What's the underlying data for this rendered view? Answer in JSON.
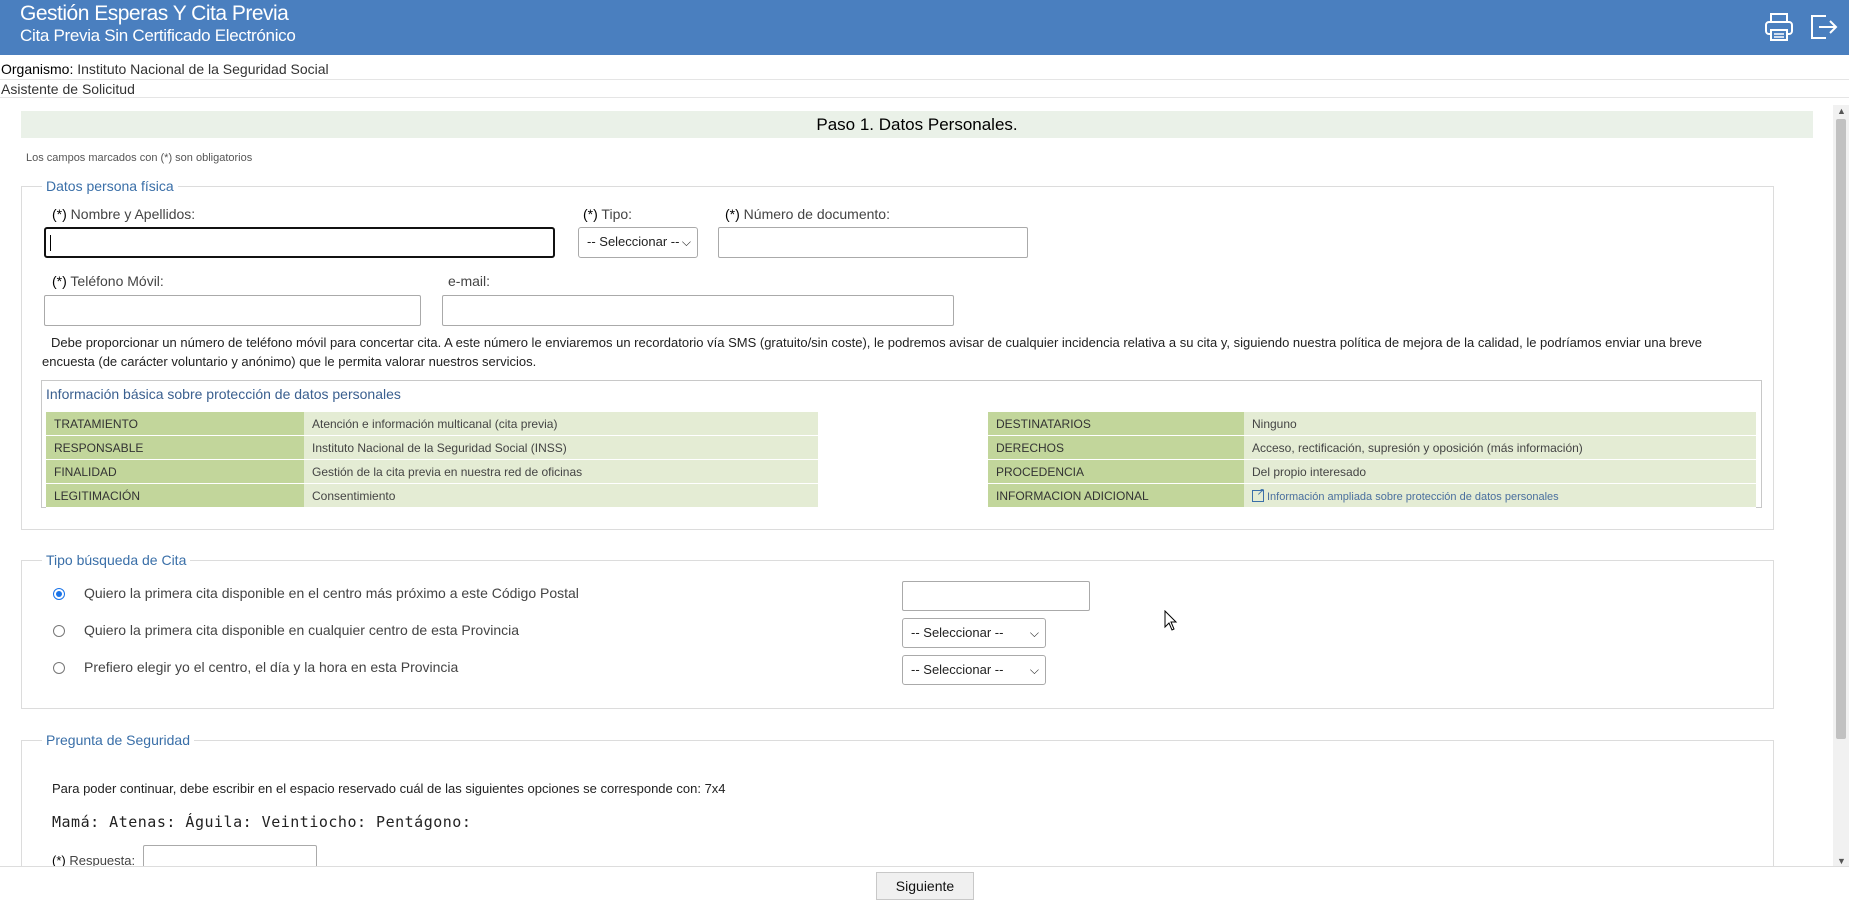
{
  "header": {
    "title": "Gestión Esperas Y Cita Previa",
    "subtitle": "Cita Previa Sin Certificado Electrónico",
    "icons": [
      "printer-icon",
      "logout-icon"
    ]
  },
  "organismo": {
    "label": "Organismo:",
    "value": "Instituto Nacional de la Seguridad Social"
  },
  "asistente": "Asistente de Solicitud",
  "step_title": "Paso 1. Datos Personales.",
  "required_note": "Los campos marcados con (*) son obligatorios",
  "persona": {
    "legend": "Datos persona física",
    "req": "(*)",
    "nombre_label": "Nombre y Apellidos:",
    "nombre_value": "",
    "tipo_label": "Tipo:",
    "tipo_value": "-- Seleccionar --",
    "documento_label": "Número de documento:",
    "documento_value": "",
    "telefono_label": "Teléfono Móvil:",
    "telefono_value": "",
    "email_label": "e-mail:",
    "email_value": "",
    "sms_note": "Debe proporcionar un número de teléfono móvil para concertar cita. A este número le enviaremos un recordatorio vía SMS (gratuito/sin coste), le podremos avisar de cualquier incidencia relativa a su cita y, siguiendo nuestra política de mejora de la calidad, le podríamos enviar una breve encuesta (de carácter voluntario y anónimo) que le permita valorar nuestros servicios."
  },
  "gdpr": {
    "title": "Información básica sobre protección de datos personales",
    "rows": [
      {
        "k1": "TRATAMIENTO",
        "v1": "Atención e información multicanal (cita previa)",
        "k2": "DESTINATARIOS",
        "v2": "Ninguno"
      },
      {
        "k1": "RESPONSABLE",
        "v1": "Instituto Nacional de la Seguridad Social (INSS)",
        "k2": "DERECHOS",
        "v2": "Acceso, rectificación, supresión y oposición (más información)"
      },
      {
        "k1": "FINALIDAD",
        "v1": "Gestión de la cita previa en nuestra red de oficinas",
        "k2": "PROCEDENCIA",
        "v2": "Del propio interesado"
      },
      {
        "k1": "LEGITIMACIÓN",
        "v1": "Consentimiento",
        "k2": "INFORMACION ADICIONAL",
        "v2": "Información ampliada sobre protección de datos personales"
      }
    ]
  },
  "busqueda": {
    "legend": "Tipo búsqueda de Cita",
    "options": [
      {
        "label": "Quiero la primera cita disponible en el centro más próximo a este Código Postal",
        "selected": true,
        "control_value": ""
      },
      {
        "label": "Quiero la primera cita disponible en cualquier centro de esta Provincia",
        "selected": false,
        "control_value": "-- Seleccionar --"
      },
      {
        "label": "Prefiero elegir yo el centro, el día y la hora en esta Provincia",
        "selected": false,
        "control_value": "-- Seleccionar --"
      }
    ]
  },
  "seguridad": {
    "legend": "Pregunta de Seguridad",
    "question": "Para poder continuar, debe escribir en el espacio reservado cuál de las siguientes opciones se corresponde con: 7x4",
    "words": "Mamá: Atenas: Águila: Veintiocho: Pentágono:",
    "respuesta_req": "(*)",
    "respuesta_label": "Respuesta:",
    "respuesta_value": ""
  },
  "footer": {
    "next_label": "Siguiente"
  },
  "colors": {
    "header_bg": "#4a7fbf",
    "legend": "#3a6fa8",
    "gdpr_key": "#c2d69b",
    "gdpr_value": "#e4ecd4",
    "step_bar": "#eaf1e8"
  }
}
